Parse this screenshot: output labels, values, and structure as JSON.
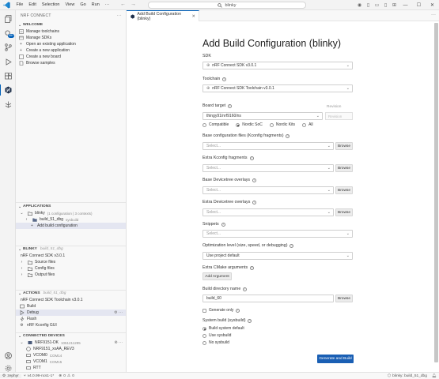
{
  "titlebar": {
    "menu": [
      "File",
      "Edit",
      "Selection",
      "View",
      "Go",
      "Run",
      "···"
    ],
    "search": "blinky"
  },
  "sidebar": {
    "title": "NRF CONNECT",
    "welcome": {
      "header": "WELCOME",
      "items": [
        "Manage toolchains",
        "Manage SDKs",
        "Open an existing application",
        "Create a new application",
        "Create a new board",
        "Browse samples"
      ]
    },
    "applications": {
      "header": "APPLICATIONS",
      "app_name": "blinky",
      "app_detail": "(1 configuration | 3 contexts)",
      "build_name": "build_51_dbg",
      "build_detail": "sysbuild",
      "add_build": "Add build configuration"
    },
    "blinky": {
      "header": "BLINKY",
      "header_detail": "build_51_dbg",
      "sdk": "nRF Connect SDK v3.0.1",
      "items": [
        "Source files",
        "Config files",
        "Output files"
      ]
    },
    "actions": {
      "header": "ACTIONS",
      "header_detail": "build_51_dbg",
      "toolchain": "nRF Connect SDK Toolchain v3.0.1",
      "items": [
        "Build",
        "Debug",
        "Flash",
        "nRF Kconfig GUI"
      ]
    },
    "devices": {
      "header": "CONNECTED DEVICES",
      "device_name": "NRF9151-DK",
      "device_serial": "1051211295",
      "core": "NRF9151_xxAA_REV3",
      "ports": [
        {
          "name": "VCOM0",
          "port": "COM14"
        },
        {
          "name": "VCOM1",
          "port": "COM15"
        }
      ],
      "rtt": "RTT"
    }
  },
  "tab": {
    "label": "Add Build Configuration (blinky)"
  },
  "form": {
    "title": "Add Build Configuration (blinky)",
    "sdk_label": "SDK",
    "sdk_value": "nRF Connect SDK v3.0.1",
    "toolchain_label": "Toolchain",
    "toolchain_value": "nRF Connect SDK Toolchain v3.0.1",
    "board_label": "Board target",
    "board_value": "thingy91/nrf9160/ns",
    "revision_label": "Revision",
    "revision_placeholder": "Revision",
    "board_filters": [
      "Compatible",
      "Nordic SoC",
      "Nordic Kits",
      "All"
    ],
    "base_conf_label": "Base configuration files (Kconfig fragments)",
    "extra_kconfig_label": "Extra Kconfig fragments",
    "base_overlay_label": "Base Devicetree overlays",
    "extra_overlay_label": "Extra Devicetree overlays",
    "snippets_label": "Snippets",
    "select_placeholder": "Select...",
    "browse": "Browse",
    "opt_label": "Optimization level (size, speed, or debugging)",
    "opt_value": "Use project default",
    "cmake_label": "Extra CMake arguments",
    "add_argument": "Add Argument",
    "build_dir_label": "Build directory name",
    "build_dir_value": "build_60",
    "generate_only": "Generate only",
    "sysbuild_label": "System build (sysbuild)",
    "sysbuild_options": [
      "Build system default",
      "Use sysbuild",
      "No sysbuild"
    ],
    "generate_button": "Generate and Build"
  },
  "statusbar": {
    "project": "zephyr",
    "version": "v4.0.99-ncs1-1*",
    "errors": "0",
    "warnings": "0",
    "context": "blinky: build_51_dbg"
  }
}
